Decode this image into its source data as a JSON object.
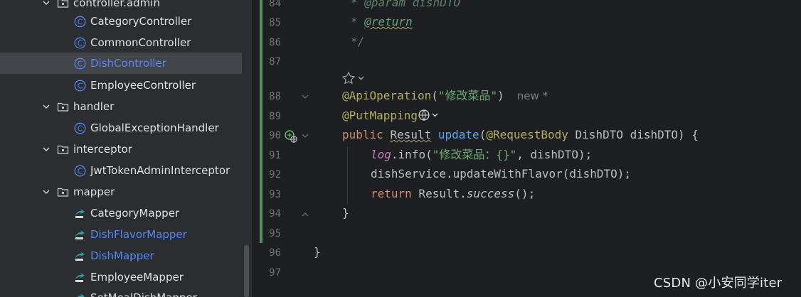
{
  "tree": {
    "items": [
      {
        "label": "controller.admin",
        "kind": "package",
        "expanded": true
      },
      {
        "label": "CategoryController",
        "kind": "class"
      },
      {
        "label": "CommonController",
        "kind": "class"
      },
      {
        "label": "DishController",
        "kind": "class",
        "selected": true
      },
      {
        "label": "EmployeeController",
        "kind": "class"
      },
      {
        "label": "handler",
        "kind": "package",
        "expanded": true
      },
      {
        "label": "GlobalExceptionHandler",
        "kind": "class"
      },
      {
        "label": "interceptor",
        "kind": "package",
        "expanded": true
      },
      {
        "label": "JwtTokenAdminInterceptor",
        "kind": "class"
      },
      {
        "label": "mapper",
        "kind": "package",
        "expanded": true
      },
      {
        "label": "CategoryMapper",
        "kind": "mapper"
      },
      {
        "label": "DishFlavorMapper",
        "kind": "mapper",
        "modified": true
      },
      {
        "label": "DishMapper",
        "kind": "mapper",
        "modified": true
      },
      {
        "label": "EmployeeMapper",
        "kind": "mapper"
      },
      {
        "label": "SetMealDishMapper",
        "kind": "mapper"
      }
    ]
  },
  "editor": {
    "line_numbers": [
      "84",
      "85",
      "86",
      "87",
      "88",
      "89",
      "90",
      "91",
      "92",
      "93",
      "94",
      "95",
      "96",
      "97"
    ],
    "doc_param": "* @param dishDTO",
    "doc_return_star": "* ",
    "doc_return_tag": "@return",
    "doc_close": "*/",
    "ann_apiop": "@ApiOperation",
    "apiop_open": "(",
    "apiop_str": "\"修改菜品\"",
    "apiop_close": ")",
    "inlay_hint": "new *",
    "ann_putmapping": "@PutMapping",
    "kw_public": "public",
    "type_result": "Result",
    "method_update": "update",
    "paren_open": "(",
    "ann_requestbody": "@RequestBody",
    "params_rest": " DishDTO dishDTO) {",
    "log_field": "log",
    "log_call": ".info(",
    "log_str": "\"修改菜品：{}\"",
    "log_rest": ", dishDTO);",
    "service_line": "dishService.updateWithFlavor(dishDTO);",
    "kw_return": "return",
    "return_type": " Result.",
    "success_call": "success",
    "success_rest": "();",
    "close_method": "}",
    "close_class": "}"
  },
  "watermark": "CSDN @小安同学iter",
  "colors": {
    "tree_bg": "#2b2d30",
    "editor_bg": "#1e1f22",
    "selected_row": "#43454a",
    "modified_file": "#548af7",
    "change_bar": "#549159"
  }
}
